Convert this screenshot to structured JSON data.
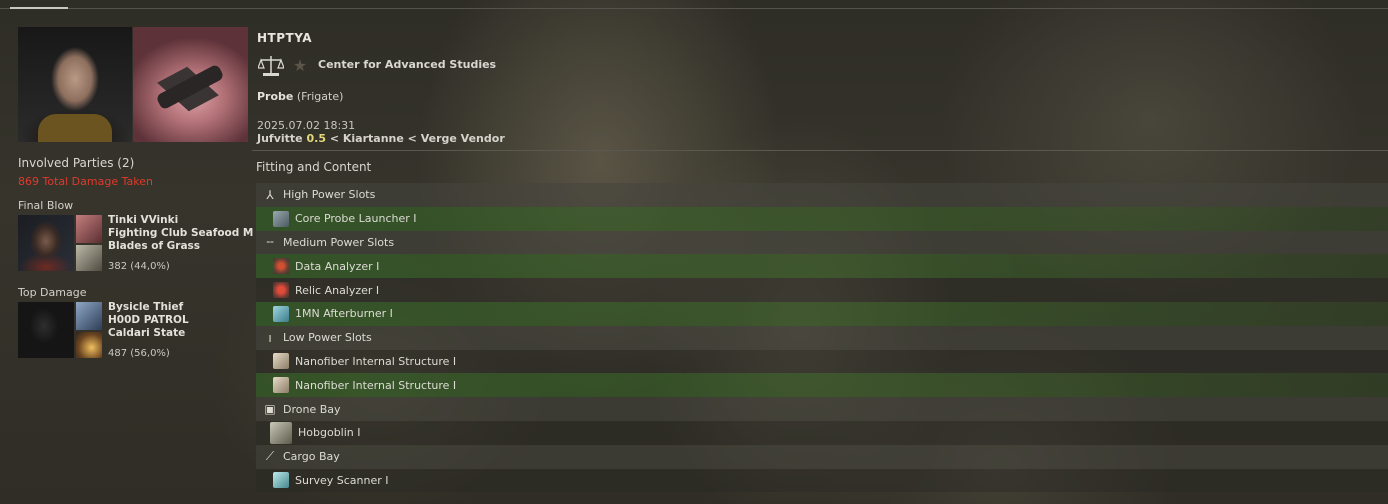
{
  "victim": {
    "name": "HTPTYA",
    "corporation": "Center for Advanced Studies",
    "ship_name": "Probe",
    "ship_class": "(Frigate)",
    "datetime": "2025.07.02 18:31",
    "system": "Jufvitte",
    "security": "0.5",
    "constellation": "< Kiartanne",
    "region": "< Verge Vendor"
  },
  "involved": {
    "title": "Involved Parties (2)",
    "total_damage": "869 Total Damage Taken"
  },
  "final_blow": {
    "label": "Final Blow",
    "name": "Tinki VVinki",
    "corp": "Fighting Club Seafood M",
    "alliance": "Blades of Grass",
    "damage": "382 (44,0%)"
  },
  "top_damage": {
    "label": "Top Damage",
    "name": "Bysicle Thief",
    "corp": "H00D PATROL",
    "alliance": "Caldari State",
    "damage": "487 (56,0%)"
  },
  "fitting": {
    "title": "Fitting and Content",
    "rows": [
      {
        "type": "header",
        "icon": "high-slot-icon",
        "glyph": "⅄",
        "label": "High Power Slots"
      },
      {
        "type": "item",
        "icon": "probe-launcher-icon",
        "cls": "ic-launcher",
        "label": "Core Probe Launcher I",
        "dropped": true
      },
      {
        "type": "header",
        "icon": "medium-slot-icon",
        "glyph": "╌",
        "label": "Medium Power Slots"
      },
      {
        "type": "item",
        "icon": "data-analyzer-icon",
        "cls": "ic-data",
        "label": "Data Analyzer I",
        "dropped": true
      },
      {
        "type": "item",
        "icon": "relic-analyzer-icon",
        "cls": "ic-relic",
        "label": "Relic Analyzer I",
        "dropped": false
      },
      {
        "type": "item",
        "icon": "afterburner-icon",
        "cls": "ic-ab",
        "label": "1MN Afterburner I",
        "dropped": true
      },
      {
        "type": "header",
        "icon": "low-slot-icon",
        "glyph": "ı",
        "label": "Low Power Slots"
      },
      {
        "type": "item",
        "icon": "nanofiber-icon",
        "cls": "ic-nano",
        "label": "Nanofiber Internal Structure I",
        "dropped": false
      },
      {
        "type": "item",
        "icon": "nanofiber-icon",
        "cls": "ic-nano",
        "label": "Nanofiber Internal Structure I",
        "dropped": true
      },
      {
        "type": "header",
        "icon": "drone-bay-icon",
        "glyph": "▣",
        "label": "Drone Bay"
      },
      {
        "type": "item",
        "icon": "hobgoblin-drone-icon",
        "cls": "ic-hob",
        "label": "Hobgoblin I",
        "dropped": false
      },
      {
        "type": "header",
        "icon": "cargo-bay-icon",
        "glyph": "⟋",
        "label": "Cargo Bay"
      },
      {
        "type": "item",
        "icon": "survey-scanner-icon",
        "cls": "ic-scan",
        "label": "Survey Scanner I",
        "dropped": false
      }
    ]
  }
}
